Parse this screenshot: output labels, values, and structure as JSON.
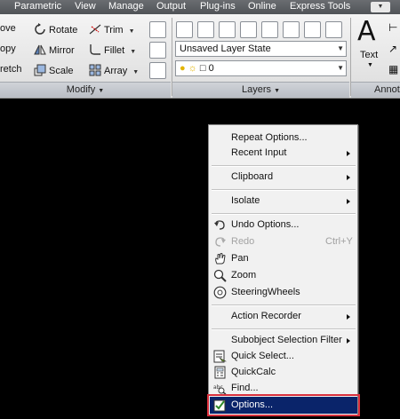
{
  "menubar": {
    "items": [
      "Parametric",
      "View",
      "Manage",
      "Output",
      "Plug-ins",
      "Online",
      "Express Tools"
    ],
    "options_icon": "chevron-down-icon"
  },
  "ribbon": {
    "modify": {
      "left_col": [
        "ove",
        "opy",
        "retch"
      ],
      "mid_col": [
        "Rotate",
        "Mirror",
        "Scale"
      ],
      "right_col": [
        "Trim",
        "Fillet",
        "Array"
      ],
      "footer": "Modify"
    },
    "layers": {
      "layer_state": "Unsaved Layer State",
      "current_layer": "0",
      "footer": "Layers"
    },
    "annotation": {
      "text_glyph": "A",
      "text_label": "Text",
      "footer": "Annota"
    }
  },
  "context_menu": {
    "items": [
      {
        "label": "Repeat Options...",
        "icon": "",
        "submenu": false
      },
      {
        "label": "Recent Input",
        "icon": "",
        "submenu": true
      },
      {
        "label": "Clipboard",
        "icon": "",
        "submenu": true
      },
      {
        "label": "Isolate",
        "icon": "",
        "submenu": true
      },
      {
        "label": "Undo Options...",
        "icon": "undo-icon",
        "submenu": false
      },
      {
        "label": "Redo",
        "shortcut": "Ctrl+Y",
        "icon": "redo-icon",
        "disabled": true
      },
      {
        "label": "Pan",
        "icon": "pan-hand-icon"
      },
      {
        "label": "Zoom",
        "icon": "zoom-magnifier-icon"
      },
      {
        "label": "SteeringWheels",
        "icon": "steering-wheel-icon"
      },
      {
        "label": "Action Recorder",
        "icon": "",
        "submenu": true
      },
      {
        "label": "Subobject Selection Filter",
        "icon": "",
        "submenu": true
      },
      {
        "label": "Quick Select...",
        "icon": "quick-select-icon"
      },
      {
        "label": "QuickCalc",
        "icon": "calculator-icon"
      },
      {
        "label": "Find...",
        "icon": "find-text-icon"
      },
      {
        "label": "Options...",
        "icon": "checkmark-options-icon",
        "selected": true
      }
    ]
  },
  "colors": {
    "selected_bg": "#0a246a",
    "highlight_border": "#d9303d",
    "drawing_area": "#000000"
  }
}
